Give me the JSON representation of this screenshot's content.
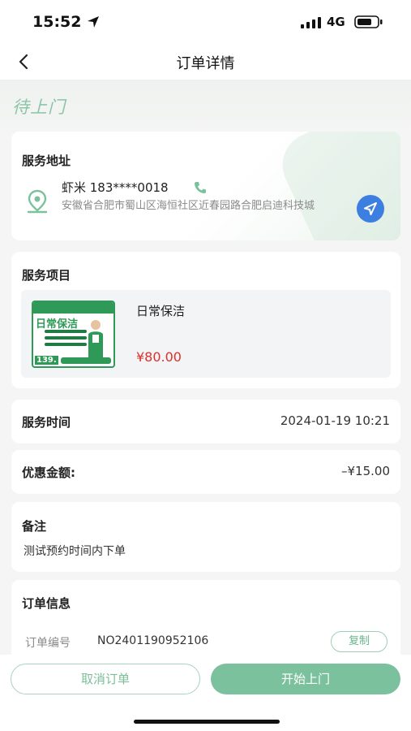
{
  "status_bar": {
    "time": "15:52",
    "network": "4G",
    "icons": [
      "location-arrow-icon",
      "signal-icon",
      "battery-icon"
    ]
  },
  "nav": {
    "title": "订单详情",
    "back_icon": "chevron-left-icon"
  },
  "order_status": "待上门",
  "address_card": {
    "title": "服务地址",
    "name_phone": "虾米 183****0018",
    "address": "安徽省合肥市蜀山区海恒社区近春园路合肥启迪科技城",
    "icons": [
      "location-pin-icon",
      "phone-icon",
      "navigate-icon"
    ]
  },
  "service_card": {
    "title": "服务项目",
    "item_name": "日常保洁",
    "item_price": "¥80.00",
    "thumb": {
      "headline": "日常保洁",
      "price_tag": "139."
    }
  },
  "service_time": {
    "label": "服务时间",
    "value": "2024-01-19 10:21"
  },
  "discount": {
    "label": "优惠金额:",
    "value": "–¥15.00"
  },
  "remark": {
    "label": "备注",
    "text": "测试预约时间内下单"
  },
  "order_info": {
    "title": "订单信息",
    "order_no_label": "订单编号",
    "order_no": "NO2401190952106",
    "copy_label": "复制"
  },
  "actions": {
    "cancel_label": "取消订单",
    "start_label": "开始上门"
  },
  "colors": {
    "accent_green": "#7cc19d",
    "price_red": "#e0302b",
    "nav_blue": "#3d7fe0"
  }
}
